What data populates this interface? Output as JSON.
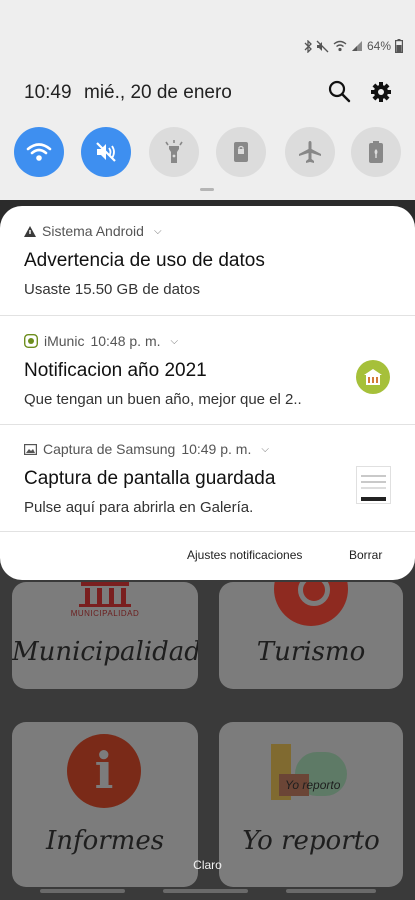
{
  "status_bar": {
    "battery_percent": "64%",
    "icons": [
      "bluetooth-icon",
      "mute-icon",
      "wifi-icon",
      "signal-icon",
      "battery-icon"
    ]
  },
  "header": {
    "time": "10:49",
    "date": "mié., 20 de enero"
  },
  "quick_settings": [
    {
      "name": "wifi",
      "icon": "wifi-icon",
      "active": true
    },
    {
      "name": "mute",
      "icon": "mute-icon",
      "active": true
    },
    {
      "name": "flashlight",
      "icon": "flashlight-icon",
      "active": false
    },
    {
      "name": "rotation-lock",
      "icon": "rotation-lock-icon",
      "active": false
    },
    {
      "name": "airplane",
      "icon": "airplane-icon",
      "active": false
    },
    {
      "name": "power-saving",
      "icon": "power-saving-icon",
      "active": false
    }
  ],
  "notifications": [
    {
      "app": "Sistema Android",
      "time": "",
      "title": "Advertencia de uso de datos",
      "text": "Usaste 15.50 GB de datos"
    },
    {
      "app": "iMunic",
      "time": "10:48 p. m.",
      "title": "Notificacion  año 2021",
      "text": "Que tengan un buen año, mejor que el 2.."
    },
    {
      "app": "Captura de Samsung",
      "time": "10:49 p. m.",
      "title": "Captura de pantalla guardada",
      "text": "Pulse aquí para abrirla en Galería."
    }
  ],
  "actions": {
    "settings_label": "Ajustes notificaciones",
    "clear_label": "Borrar"
  },
  "background_app": {
    "tiles": [
      "Municipalidad",
      "Turismo",
      "Informes",
      "Yo reporto"
    ],
    "muni_subtitle": "MUNICIPALIDAD",
    "yo_reporto_logo": "Yo reporto"
  },
  "carrier": "Claro",
  "colors": {
    "accent": "#3e8ff0",
    "panel": "#ffffff",
    "shade": "#eeeeee"
  }
}
